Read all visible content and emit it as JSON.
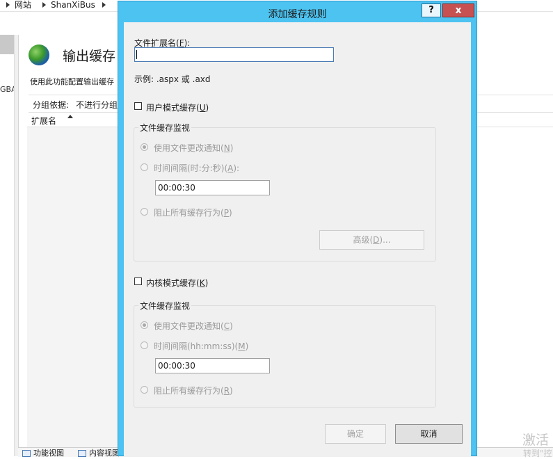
{
  "background": {
    "breadcrumb": [
      "网站",
      "ShanXiBus"
    ],
    "left_tree_text": "GBA",
    "feature": {
      "title": "输出缓存",
      "description": "使用此功能配置输出缓存"
    },
    "group_by": {
      "label": "分组依据:",
      "value": "不进行分组"
    },
    "list_header": {
      "extension": "扩展名"
    },
    "bottom_tabs": [
      "功能视图",
      "内容视图"
    ],
    "watermark": {
      "line1": "激活",
      "line2": "转到\"控"
    }
  },
  "dialog": {
    "title": "添加缓存规则",
    "help_label": "?",
    "close_label": "x",
    "extension": {
      "label": "文件扩展名",
      "accesskey": "F",
      "value": "",
      "example": "示例: .aspx 或 .axd"
    },
    "user_mode": {
      "label": "用户模式缓存",
      "accesskey": "U",
      "checked": false,
      "group_title": "文件缓存监视",
      "radio_notify": {
        "label": "使用文件更改通知",
        "accesskey": "N",
        "checked": true
      },
      "radio_interval": {
        "label": "时间间隔(时:分:秒)",
        "accesskey": "A",
        "checked": false
      },
      "interval_value": "00:00:30",
      "radio_prevent": {
        "label": "阻止所有缓存行为",
        "accesskey": "P",
        "checked": false
      },
      "advanced_label": "高级",
      "advanced_accesskey": "D",
      "advanced_suffix": "..."
    },
    "kernel_mode": {
      "label": "内核模式缓存",
      "accesskey": "K",
      "checked": false,
      "group_title": "文件缓存监视",
      "radio_notify": {
        "label": "使用文件更改通知",
        "accesskey": "C",
        "checked": true
      },
      "radio_interval": {
        "label": "时间间隔(hh:mm:ss)",
        "accesskey": "M",
        "checked": false
      },
      "interval_value": "00:00:30",
      "radio_prevent": {
        "label": "阻止所有缓存行为",
        "accesskey": "R",
        "checked": false
      }
    },
    "ok_label": "确定",
    "cancel_label": "取消"
  }
}
